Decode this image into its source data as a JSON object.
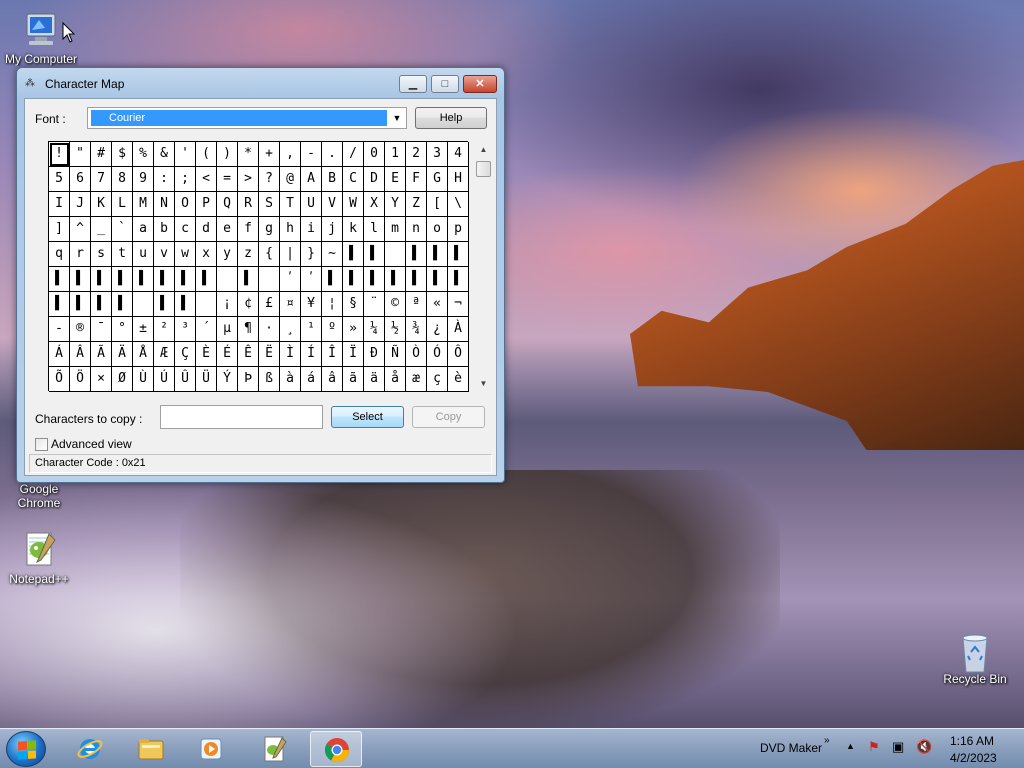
{
  "desktop": {
    "icons": [
      {
        "label": "My Computer"
      },
      {
        "label": "Google Chrome"
      },
      {
        "label": "Notepad++"
      },
      {
        "label": "Recycle Bin"
      }
    ]
  },
  "window": {
    "title": "Character Map",
    "font_label": "Font :",
    "font_value": "Courier",
    "help_label": "Help",
    "characters": [
      [
        "!",
        "\"",
        "#",
        "$",
        "%",
        "&",
        "'",
        "(",
        ")",
        "*",
        "+",
        ",",
        "-",
        ".",
        "/",
        "0",
        "1",
        "2",
        "3",
        "4"
      ],
      [
        "5",
        "6",
        "7",
        "8",
        "9",
        ":",
        ";",
        "<",
        "=",
        ">",
        "?",
        "@",
        "A",
        "B",
        "C",
        "D",
        "E",
        "F",
        "G",
        "H"
      ],
      [
        "I",
        "J",
        "K",
        "L",
        "M",
        "N",
        "O",
        "P",
        "Q",
        "R",
        "S",
        "T",
        "U",
        "V",
        "W",
        "X",
        "Y",
        "Z",
        "[",
        "\\"
      ],
      [
        "]",
        "^",
        "_",
        "`",
        "a",
        "b",
        "c",
        "d",
        "e",
        "f",
        "g",
        "h",
        "i",
        "j",
        "k",
        "l",
        "m",
        "n",
        "o",
        "p"
      ],
      [
        "q",
        "r",
        "s",
        "t",
        "u",
        "v",
        "w",
        "x",
        "y",
        "z",
        "{",
        "|",
        "}",
        "~",
        "▌",
        "▌",
        "",
        "▌",
        "▌",
        "▌"
      ],
      [
        "▌",
        "▌",
        "▌",
        "▌",
        "▌",
        "▌",
        "▌",
        "▌",
        "",
        "▌",
        "",
        "ʹ",
        "ʹ",
        "▌",
        "▌",
        "▌",
        "▌",
        "▌",
        "▌",
        "▌"
      ],
      [
        "▌",
        "▌",
        "▌",
        "▌",
        "",
        "▌",
        "▌",
        "",
        "¡",
        "¢",
        "£",
        "¤",
        "¥",
        "¦",
        "§",
        "¨",
        "©",
        "ª",
        "«",
        "¬"
      ],
      [
        "-",
        "®",
        "¯",
        "°",
        "±",
        "²",
        "³",
        "´",
        "µ",
        "¶",
        "·",
        "¸",
        "¹",
        "º",
        "»",
        "¼",
        "½",
        "¾",
        "¿",
        "À"
      ],
      [
        "Á",
        "Â",
        "Ã",
        "Ä",
        "Å",
        "Æ",
        "Ç",
        "È",
        "É",
        "Ê",
        "Ë",
        "Ì",
        "Í",
        "Î",
        "Ï",
        "Ð",
        "Ñ",
        "Ò",
        "Ó",
        "Ô"
      ],
      [
        "Õ",
        "Ö",
        "×",
        "Ø",
        "Ù",
        "Ú",
        "Û",
        "Ü",
        "Ý",
        "Þ",
        "ß",
        "à",
        "á",
        "â",
        "ã",
        "ä",
        "å",
        "æ",
        "ç",
        "è"
      ]
    ],
    "copy_label": "Characters to copy :",
    "copy_value": "",
    "select_label": "Select",
    "copy_button_label": "Copy",
    "advanced_label": "Advanced view",
    "advanced_checked": false,
    "status": "Character Code : 0x21",
    "minimize_glyph": "▁",
    "maximize_glyph": "□",
    "close_glyph": "✕"
  },
  "taskbar": {
    "items": [
      {
        "icon": "internet-explorer-icon"
      },
      {
        "icon": "file-explorer-icon"
      },
      {
        "icon": "media-player-icon"
      },
      {
        "icon": "notepad-plus-plus-icon"
      },
      {
        "icon": "google-chrome-icon",
        "active": true
      }
    ],
    "tray_app_label": "DVD Maker",
    "time": "1:16 AM",
    "date": "4/2/2023"
  },
  "colors": {
    "selection": "#3399ff",
    "taskbar": "#9bb4d1"
  }
}
